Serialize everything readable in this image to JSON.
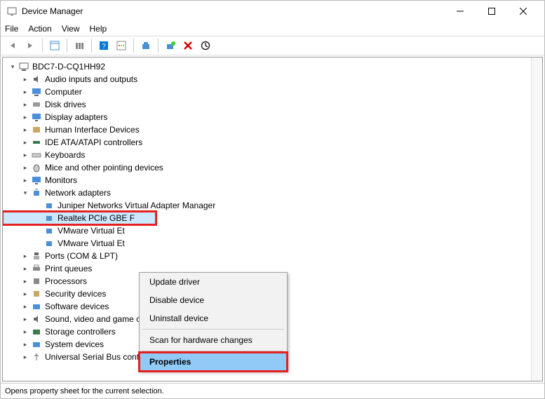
{
  "window": {
    "title": "Device Manager"
  },
  "menubar": {
    "file": "File",
    "action": "Action",
    "view": "View",
    "help": "Help"
  },
  "tree": {
    "root": "BDC7-D-CQ1HH92",
    "audio": "Audio inputs and outputs",
    "computer": "Computer",
    "disk": "Disk drives",
    "display": "Display adapters",
    "hid": "Human Interface Devices",
    "ide": "IDE ATA/ATAPI controllers",
    "keyboards": "Keyboards",
    "mice": "Mice and other pointing devices",
    "monitors": "Monitors",
    "network": "Network adapters",
    "net_children": {
      "juniper": "Juniper Networks Virtual Adapter Manager",
      "realtek": "Realtek PCIe GBE F",
      "vmware1": "VMware Virtual Et",
      "vmware2": "VMware Virtual Et"
    },
    "ports": "Ports (COM & LPT)",
    "print": "Print queues",
    "processors": "Processors",
    "security": "Security devices",
    "software": "Software devices",
    "sound": "Sound, video and game controllers",
    "storage": "Storage controllers",
    "system": "System devices",
    "usb": "Universal Serial Bus controllers"
  },
  "context_menu": {
    "update": "Update driver",
    "disable": "Disable device",
    "uninstall": "Uninstall device",
    "scan": "Scan for hardware changes",
    "properties": "Properties"
  },
  "statusbar": {
    "text": "Opens property sheet for the current selection."
  }
}
